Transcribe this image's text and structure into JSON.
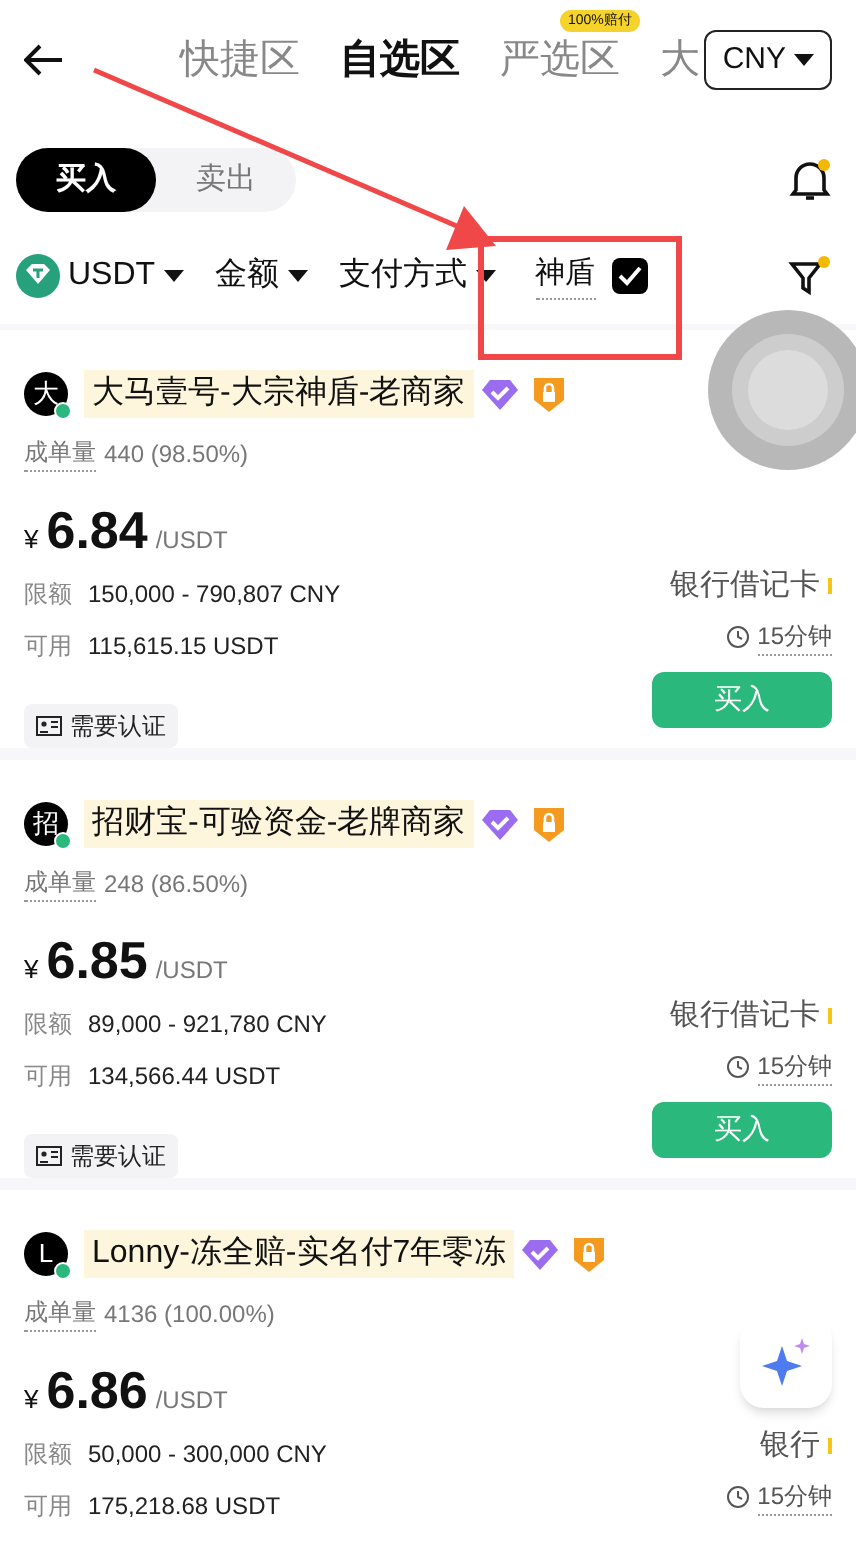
{
  "header": {
    "tabs": [
      {
        "label": "快捷区",
        "selected": false
      },
      {
        "label": "自选区",
        "selected": true
      },
      {
        "label": "严选区",
        "selected": false,
        "badge": "100%赔付"
      },
      {
        "label": "大",
        "selected": false
      }
    ],
    "currency": "CNY"
  },
  "trade_toggle": [
    {
      "label": "买入",
      "selected": true
    },
    {
      "label": "卖出",
      "selected": false
    }
  ],
  "filters": {
    "coin": "USDT",
    "amount": "金额",
    "payment": "支付方式",
    "shield": {
      "label": "神盾",
      "checked": true
    }
  },
  "ads": [
    {
      "avatar": "大",
      "name": "大马壹号-大宗神盾-老商家",
      "orders_label": "成单量",
      "orders": "440 (98.50%)",
      "currency_sign": "¥",
      "price": "6.84",
      "unit": "/USDT",
      "limit_label": "限额",
      "limit": "150,000 - 790,807 CNY",
      "available_label": "可用",
      "available": "115,615.15 USDT",
      "payment": "银行借记卡",
      "time": "15分钟",
      "verify": "需要认证",
      "button": "买入"
    },
    {
      "avatar": "招",
      "name": "招财宝-可验资金-老牌商家",
      "orders_label": "成单量",
      "orders": "248 (86.50%)",
      "currency_sign": "¥",
      "price": "6.85",
      "unit": "/USDT",
      "limit_label": "限额",
      "limit": "89,000 - 921,780 CNY",
      "available_label": "可用",
      "available": "134,566.44 USDT",
      "payment": "银行借记卡",
      "time": "15分钟",
      "verify": "需要认证",
      "button": "买入"
    },
    {
      "avatar": "L",
      "name": "Lonny-冻全赔-实名付7年零冻",
      "orders_label": "成单量",
      "orders": "4136 (100.00%)",
      "currency_sign": "¥",
      "price": "6.86",
      "unit": "/USDT",
      "limit_label": "限额",
      "limit": "50,000 - 300,000 CNY",
      "available_label": "可用",
      "available": "175,218.68 USDT",
      "payment": "银行",
      "time": "15分钟"
    }
  ]
}
